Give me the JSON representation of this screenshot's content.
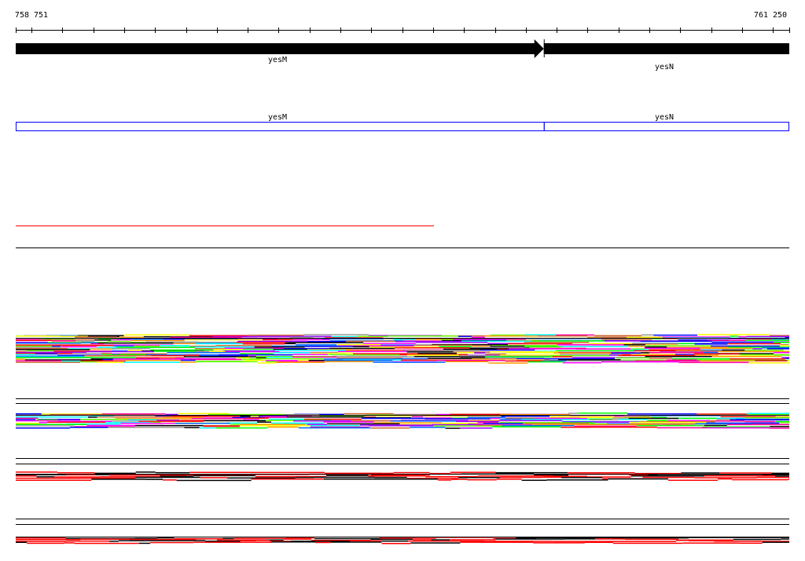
{
  "ruler": {
    "start_label": "758 751",
    "end_label": "761 250",
    "start": 758751,
    "end": 761250
  },
  "genes": [
    {
      "name": "yesM",
      "start": 758751,
      "end": 760456,
      "strand": "+"
    },
    {
      "name": "yesN",
      "end": 761250,
      "start": 760457,
      "strand": "+"
    }
  ],
  "annotations": [
    {
      "name": "yesM"
    },
    {
      "name": "yesN"
    }
  ],
  "colors": {
    "gene": "#000000",
    "annotation_box": "#0000ff",
    "coverage_line": "#ff0000",
    "track_palette": [
      "#ff0000",
      "#00ff00",
      "#0000ff",
      "#ff00ff",
      "#00ffff",
      "#ffff00",
      "#ff9900",
      "#999999",
      "#000000",
      "#9900ff",
      "#0066ff",
      "#66ff00",
      "#cc6633",
      "#ff0099"
    ]
  }
}
